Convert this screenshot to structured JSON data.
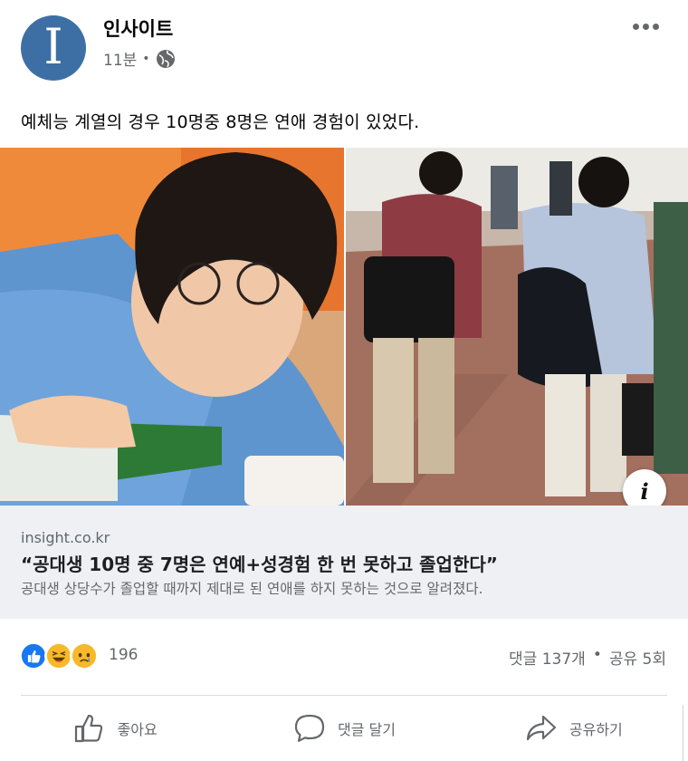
{
  "header": {
    "avatar_letter": "I",
    "page_name": "인사이트",
    "time": "11분",
    "separator": "•",
    "privacy_icon": "globe-icon",
    "more_icon": "more-horizontal-icon"
  },
  "post": {
    "caption": "예체능 계열의 경우 10명중 8명은 연애 경험이 있었다."
  },
  "link_preview": {
    "domain": "insight.co.kr",
    "title": "“공대생 10명 중 7명은 연예+성경험 한 번 못하고 졸업한다”",
    "description": "공대생 상당수가 졸업할 때까지 제대로 된 연애를 하지 못하는 것으로 알려졌다.",
    "info_label": "i"
  },
  "reactions": {
    "icons": [
      "like-reaction-icon",
      "haha-reaction-icon",
      "sad-reaction-icon"
    ],
    "count": "196",
    "comments": "댓글 137개",
    "separator": "•",
    "shares": "공유 5회"
  },
  "actions": {
    "like_label": "좋아요",
    "comment_label": "댓글 달기",
    "share_label": "공유하기"
  },
  "colors": {
    "avatar": "#3d6fa5",
    "like": "#1877f2",
    "haha": "#f7b928",
    "link_bg": "#eef0f3",
    "secondary_text": "#65676b"
  }
}
